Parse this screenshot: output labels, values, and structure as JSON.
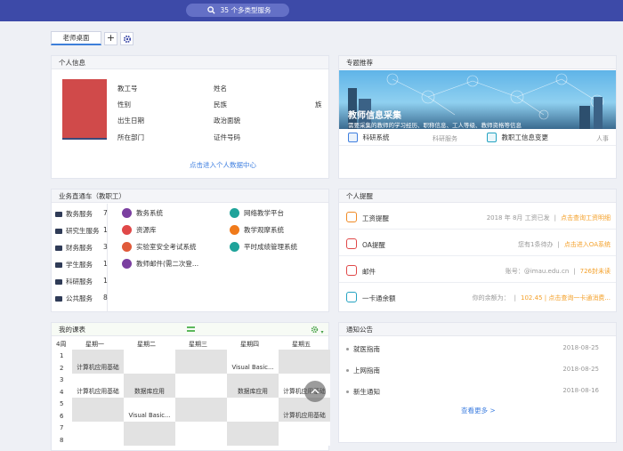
{
  "search": {
    "label": "35 个多类型服务"
  },
  "tabs": {
    "active": "老师桌面",
    "add_label": "+"
  },
  "profile": {
    "title": "个人信息",
    "fields_left": [
      "教工号",
      "性别",
      "出生日期",
      "所在部门"
    ],
    "fields_right": [
      "姓名",
      "民族",
      "政治面貌",
      "证件号码"
    ],
    "ethnic_suffix": "族",
    "link": "点击进入个人数据中心"
  },
  "topic": {
    "title": "专题推荐",
    "banner_title": "教师信息采集",
    "banner_sub": "需要采集的教师的学习经历、职称信息、工人等级、教师资格等信息",
    "items": [
      {
        "label": "科研系统",
        "tag": "科研服务"
      },
      {
        "label": "教职工信息变更",
        "tag": "人事"
      }
    ]
  },
  "business": {
    "title": "业务直通车（教职工）",
    "categories": [
      {
        "label": "教务服务",
        "count": "7"
      },
      {
        "label": "研究生服务",
        "count": "1"
      },
      {
        "label": "财务服务",
        "count": "3"
      },
      {
        "label": "学生服务",
        "count": "1"
      },
      {
        "label": "科研服务",
        "count": "1"
      },
      {
        "label": "公共服务",
        "count": "8"
      }
    ],
    "apps_col1": [
      "教务系统",
      "资源库",
      "实验室安全考试系统",
      "教师邮件(需二次登..."
    ],
    "apps_col2": [
      "网络教学平台",
      "教学观摩系统",
      "平时成绩管理系统"
    ]
  },
  "reminders": {
    "title": "个人提醒",
    "items": [
      {
        "label": "工资提醒",
        "info": "2018 年 8月 工资已发",
        "link": "点击查询工资明细"
      },
      {
        "label": "OA提醒",
        "info": "您有1条待办",
        "link": "点击进入OA系统"
      },
      {
        "label": "邮件",
        "info": "账号：@imau.edu.cn",
        "link": "726封未读"
      },
      {
        "label": "一卡通余额",
        "info": "你的余额为：",
        "link": "102.45 | 点击查询一卡通消费..."
      }
    ]
  },
  "schedule": {
    "title": "我的课表",
    "week": "4周",
    "days": [
      "星期一",
      "星期二",
      "星期三",
      "星期四",
      "星期五"
    ],
    "periods": [
      "1",
      "2",
      "3",
      "4",
      "5",
      "6",
      "7",
      "8"
    ],
    "cells": [
      [
        "",
        "",
        "",
        "",
        ""
      ],
      [
        "计算机应用基础",
        "",
        "",
        "Visual Basic...",
        ""
      ],
      [
        "",
        "",
        "",
        "",
        ""
      ],
      [
        "计算机应用基础",
        "数据库应用",
        "",
        "数据库应用",
        "计算机应用基础"
      ],
      [
        "",
        "",
        "",
        "",
        ""
      ],
      [
        "",
        "Visual Basic...",
        "",
        "",
        "计算机应用基础"
      ],
      [
        "",
        "",
        "",
        "",
        ""
      ],
      [
        "",
        "",
        "",
        "",
        ""
      ]
    ]
  },
  "notices": {
    "title": "通知公告",
    "items": [
      {
        "label": "就医指南",
        "date": "2018-08-25"
      },
      {
        "label": "上网指南",
        "date": "2018-08-25"
      },
      {
        "label": "新生通知",
        "date": "2018-08-16"
      }
    ],
    "more": "查看更多 >"
  }
}
